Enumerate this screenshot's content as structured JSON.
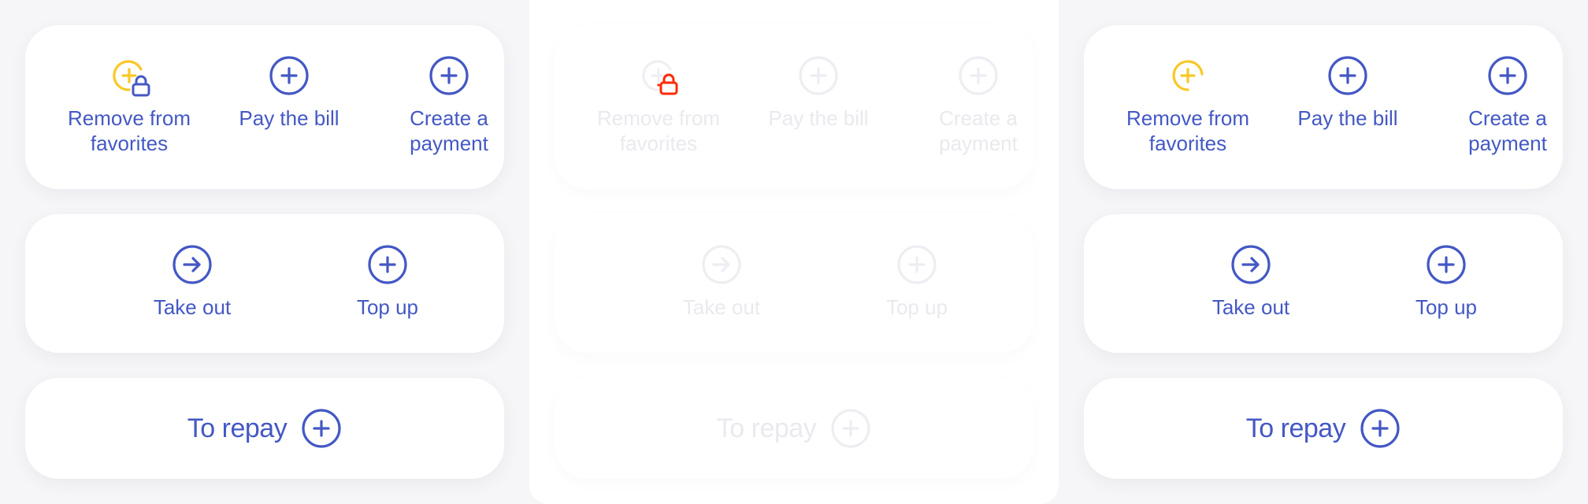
{
  "colors": {
    "accent": "#4458c4",
    "favorite": "#f8c826",
    "locked": "#ff2a00",
    "disabled": "#e9eaef",
    "background": "#f6f6f8",
    "card": "#ffffff"
  },
  "states": [
    {
      "id": "locked",
      "actions": {
        "remove_favorites": "Remove from favorites",
        "pay_bill": "Pay the bill",
        "create_payment": "Create a payment",
        "take_out": "Take out",
        "top_up": "Top up",
        "to_repay": "To repay"
      }
    },
    {
      "id": "disabled",
      "actions": {
        "remove_favorites": "Remove from favorites",
        "pay_bill": "Pay the bill",
        "create_payment": "Create a payment",
        "take_out": "Take out",
        "top_up": "Top up",
        "to_repay": "To repay"
      }
    },
    {
      "id": "default",
      "actions": {
        "remove_favorites": "Remove from favorites",
        "pay_bill": "Pay the bill",
        "create_payment": "Create a payment",
        "take_out": "Take out",
        "top_up": "Top up",
        "to_repay": "To repay"
      }
    }
  ],
  "icons": {
    "favorite": "plus-circle-partial-icon",
    "lock": "lock-icon",
    "plus": "plus-circle-icon",
    "arrow": "arrow-right-circle-icon"
  }
}
